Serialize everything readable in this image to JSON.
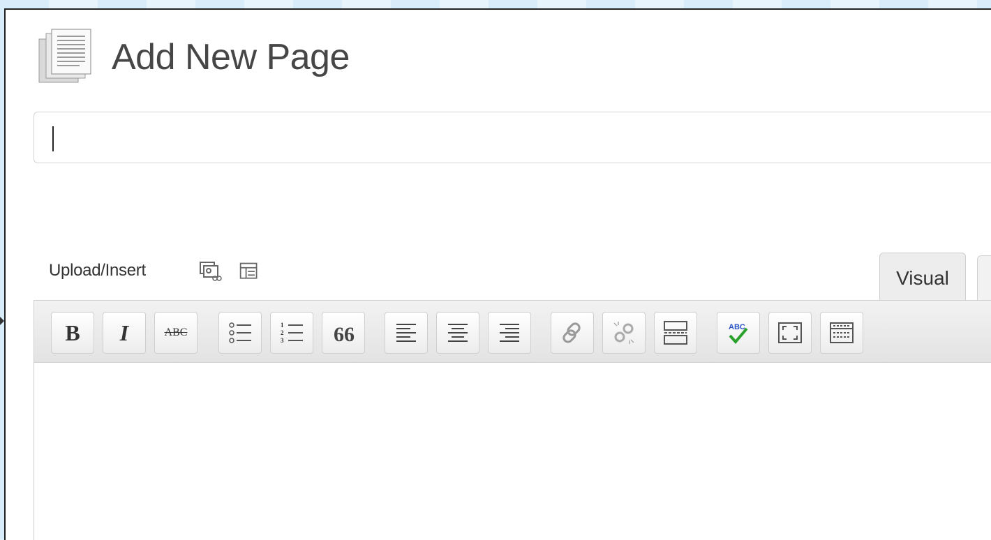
{
  "page": {
    "title": "Add New Page"
  },
  "title_input": {
    "value": "",
    "placeholder": ""
  },
  "media": {
    "label": "Upload/Insert",
    "icons": [
      "add-media-icon",
      "add-form-icon"
    ]
  },
  "editor_tabs": {
    "visual_label": "Visual"
  },
  "toolbar": {
    "bold_label": "B",
    "italic_label": "I",
    "strikethrough_label": "ABC",
    "buttons": [
      "bold",
      "italic",
      "strikethrough",
      "bulleted-list",
      "numbered-list",
      "blockquote",
      "align-left",
      "align-center",
      "align-right",
      "insert-link",
      "remove-link",
      "insert-more-tag",
      "spellcheck",
      "fullscreen",
      "kitchen-sink"
    ]
  },
  "colors": {
    "accent_check": "#2aa12a",
    "spell_text": "#2a55c8"
  }
}
